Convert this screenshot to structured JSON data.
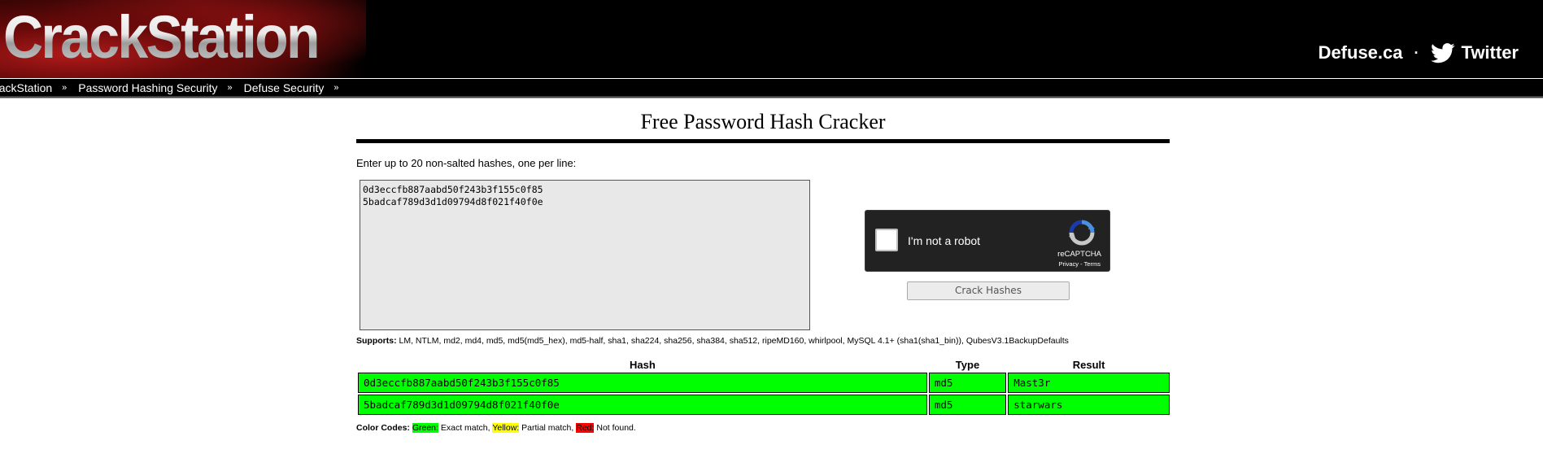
{
  "header": {
    "logo_text": "CrackStation",
    "link_defuse": "Defuse.ca",
    "separator": "·",
    "link_twitter": "Twitter",
    "twitter_icon": "twitter-bird-icon"
  },
  "nav": {
    "items": [
      {
        "label": "CrackStation"
      },
      {
        "label": "Password Hashing Security"
      },
      {
        "label": "Defuse Security"
      }
    ],
    "chevron": "»"
  },
  "main": {
    "title": "Free Password Hash Cracker",
    "instructions": "Enter up to 20 non-salted hashes, one per line:",
    "textarea_value": "0d3eccfb887aabd50f243b3f155c0f85\n5badcaf789d3d1d09794d8f021f40f0e",
    "captcha": {
      "label": "I'm not a robot",
      "brand": "reCAPTCHA",
      "terms": "Privacy - Terms"
    },
    "crack_button": "Crack Hashes",
    "supports_label": "Supports:",
    "supports_text": "LM, NTLM, md2, md4, md5, md5(md5_hex), md5-half, sha1, sha224, sha256, sha384, sha512, ripeMD160, whirlpool, MySQL 4.1+ (sha1(sha1_bin)), QubesV3.1BackupDefaults"
  },
  "results": {
    "headers": [
      "Hash",
      "Type",
      "Result"
    ],
    "rows": [
      {
        "hash": "0d3eccfb887aabd50f243b3f155c0f85",
        "type": "md5",
        "result": "Mast3r"
      },
      {
        "hash": "5badcaf789d3d1d09794d8f021f40f0e",
        "type": "md5",
        "result": "starwars"
      }
    ],
    "match_color": "#00ff00"
  },
  "color_codes": {
    "label": "Color Codes:",
    "green": "Green:",
    "green_desc": "Exact match,",
    "yellow": "Yellow:",
    "yellow_desc": "Partial match,",
    "red": "Red:",
    "red_desc": "Not found."
  }
}
